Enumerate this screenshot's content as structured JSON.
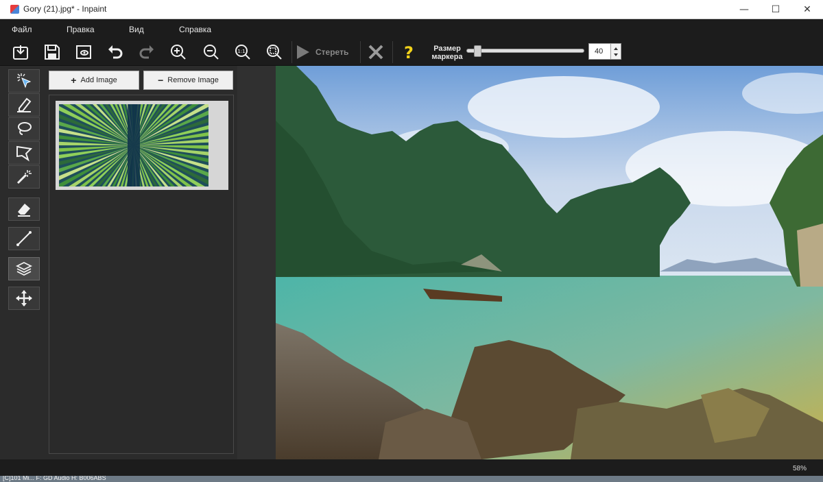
{
  "window": {
    "title": "Gory (21).jpg* - Inpaint",
    "minimize_glyph": "—",
    "maximize_glyph": "☐",
    "close_glyph": "✕"
  },
  "menu": [
    "Файл",
    "Правка",
    "Вид",
    "Справка"
  ],
  "toolbar": {
    "buttons": [
      "open-icon",
      "save-icon",
      "save-as-icon",
      "undo-icon",
      "redo-icon",
      "zoom-in-icon",
      "zoom-out-icon",
      "zoom-actual-size-icon",
      "zoom-fit-icon"
    ],
    "erase_label": "Стереть",
    "cancel_icon": "cross-icon",
    "help_icon": "question-icon",
    "marker_size_label": "Размер маркера",
    "marker_size_value": "40",
    "marker_size_fraction": 0.07
  },
  "tools": [
    "selection-icon",
    "marker-icon",
    "lasso-icon",
    "polygonal-lasso-icon",
    "magic-wand-icon",
    "eraser-icon",
    "line-icon",
    "layers-icon",
    "move-icon"
  ],
  "layers_panel": {
    "add_label": "Add Image",
    "remove_label": "Remove Image",
    "layers": [
      {
        "thumbnail": "green-radial-burst"
      }
    ]
  },
  "status": {
    "zoom": "58%"
  },
  "taskbar": {
    "text": "[C]101 Mi...   F: GD Audio   H: B006ABS"
  },
  "colors": {
    "chrome_dark": "#1c1c1c",
    "panel": "#2b2b2b",
    "canvas": "#303030",
    "help_yellow": "#f2d21a"
  }
}
